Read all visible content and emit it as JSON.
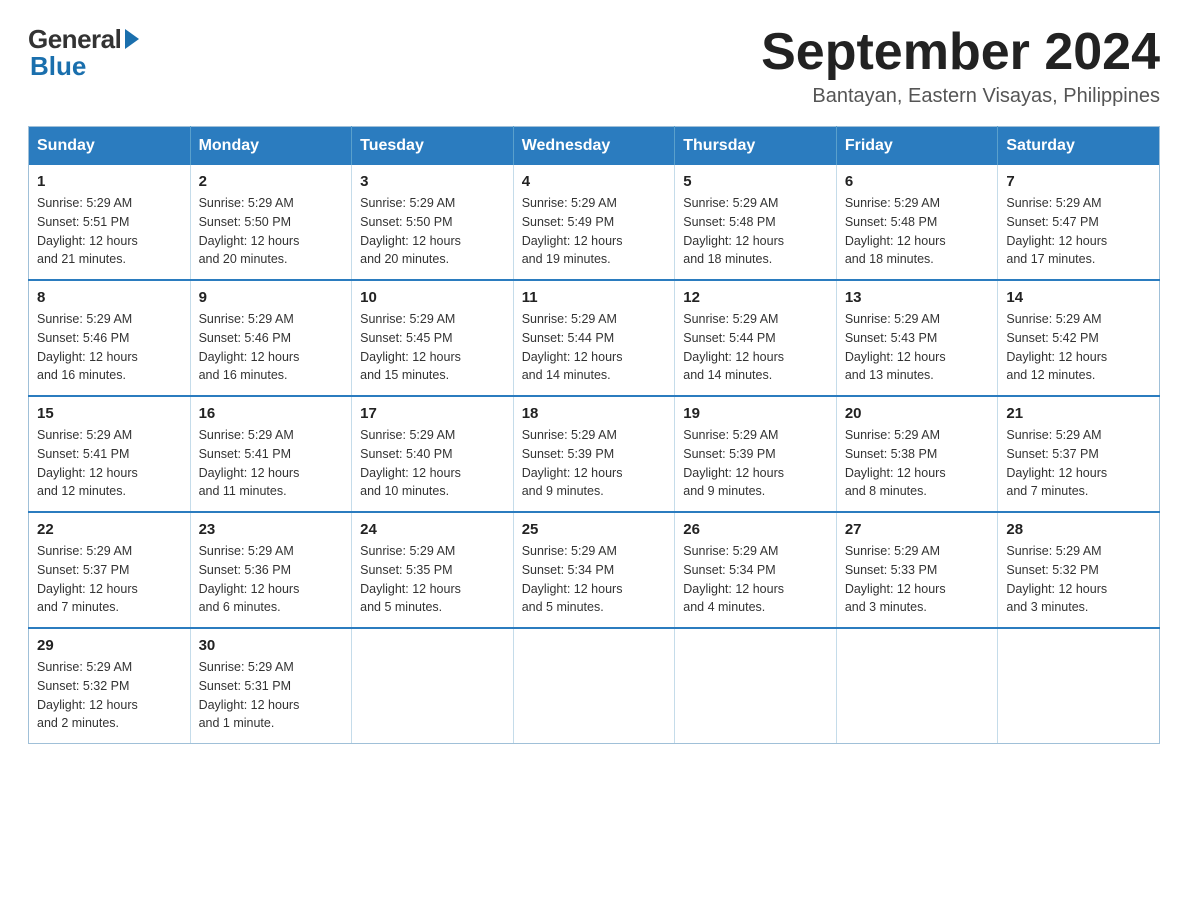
{
  "logo": {
    "general": "General",
    "blue": "Blue"
  },
  "title": "September 2024",
  "location": "Bantayan, Eastern Visayas, Philippines",
  "days_of_week": [
    "Sunday",
    "Monday",
    "Tuesday",
    "Wednesday",
    "Thursday",
    "Friday",
    "Saturday"
  ],
  "weeks": [
    [
      {
        "day": "1",
        "sunrise": "5:29 AM",
        "sunset": "5:51 PM",
        "daylight": "12 hours and 21 minutes."
      },
      {
        "day": "2",
        "sunrise": "5:29 AM",
        "sunset": "5:50 PM",
        "daylight": "12 hours and 20 minutes."
      },
      {
        "day": "3",
        "sunrise": "5:29 AM",
        "sunset": "5:50 PM",
        "daylight": "12 hours and 20 minutes."
      },
      {
        "day": "4",
        "sunrise": "5:29 AM",
        "sunset": "5:49 PM",
        "daylight": "12 hours and 19 minutes."
      },
      {
        "day": "5",
        "sunrise": "5:29 AM",
        "sunset": "5:48 PM",
        "daylight": "12 hours and 18 minutes."
      },
      {
        "day": "6",
        "sunrise": "5:29 AM",
        "sunset": "5:48 PM",
        "daylight": "12 hours and 18 minutes."
      },
      {
        "day": "7",
        "sunrise": "5:29 AM",
        "sunset": "5:47 PM",
        "daylight": "12 hours and 17 minutes."
      }
    ],
    [
      {
        "day": "8",
        "sunrise": "5:29 AM",
        "sunset": "5:46 PM",
        "daylight": "12 hours and 16 minutes."
      },
      {
        "day": "9",
        "sunrise": "5:29 AM",
        "sunset": "5:46 PM",
        "daylight": "12 hours and 16 minutes."
      },
      {
        "day": "10",
        "sunrise": "5:29 AM",
        "sunset": "5:45 PM",
        "daylight": "12 hours and 15 minutes."
      },
      {
        "day": "11",
        "sunrise": "5:29 AM",
        "sunset": "5:44 PM",
        "daylight": "12 hours and 14 minutes."
      },
      {
        "day": "12",
        "sunrise": "5:29 AM",
        "sunset": "5:44 PM",
        "daylight": "12 hours and 14 minutes."
      },
      {
        "day": "13",
        "sunrise": "5:29 AM",
        "sunset": "5:43 PM",
        "daylight": "12 hours and 13 minutes."
      },
      {
        "day": "14",
        "sunrise": "5:29 AM",
        "sunset": "5:42 PM",
        "daylight": "12 hours and 12 minutes."
      }
    ],
    [
      {
        "day": "15",
        "sunrise": "5:29 AM",
        "sunset": "5:41 PM",
        "daylight": "12 hours and 12 minutes."
      },
      {
        "day": "16",
        "sunrise": "5:29 AM",
        "sunset": "5:41 PM",
        "daylight": "12 hours and 11 minutes."
      },
      {
        "day": "17",
        "sunrise": "5:29 AM",
        "sunset": "5:40 PM",
        "daylight": "12 hours and 10 minutes."
      },
      {
        "day": "18",
        "sunrise": "5:29 AM",
        "sunset": "5:39 PM",
        "daylight": "12 hours and 9 minutes."
      },
      {
        "day": "19",
        "sunrise": "5:29 AM",
        "sunset": "5:39 PM",
        "daylight": "12 hours and 9 minutes."
      },
      {
        "day": "20",
        "sunrise": "5:29 AM",
        "sunset": "5:38 PM",
        "daylight": "12 hours and 8 minutes."
      },
      {
        "day": "21",
        "sunrise": "5:29 AM",
        "sunset": "5:37 PM",
        "daylight": "12 hours and 7 minutes."
      }
    ],
    [
      {
        "day": "22",
        "sunrise": "5:29 AM",
        "sunset": "5:37 PM",
        "daylight": "12 hours and 7 minutes."
      },
      {
        "day": "23",
        "sunrise": "5:29 AM",
        "sunset": "5:36 PM",
        "daylight": "12 hours and 6 minutes."
      },
      {
        "day": "24",
        "sunrise": "5:29 AM",
        "sunset": "5:35 PM",
        "daylight": "12 hours and 5 minutes."
      },
      {
        "day": "25",
        "sunrise": "5:29 AM",
        "sunset": "5:34 PM",
        "daylight": "12 hours and 5 minutes."
      },
      {
        "day": "26",
        "sunrise": "5:29 AM",
        "sunset": "5:34 PM",
        "daylight": "12 hours and 4 minutes."
      },
      {
        "day": "27",
        "sunrise": "5:29 AM",
        "sunset": "5:33 PM",
        "daylight": "12 hours and 3 minutes."
      },
      {
        "day": "28",
        "sunrise": "5:29 AM",
        "sunset": "5:32 PM",
        "daylight": "12 hours and 3 minutes."
      }
    ],
    [
      {
        "day": "29",
        "sunrise": "5:29 AM",
        "sunset": "5:32 PM",
        "daylight": "12 hours and 2 minutes."
      },
      {
        "day": "30",
        "sunrise": "5:29 AM",
        "sunset": "5:31 PM",
        "daylight": "12 hours and 1 minute."
      },
      null,
      null,
      null,
      null,
      null
    ]
  ],
  "labels": {
    "sunrise": "Sunrise:",
    "sunset": "Sunset:",
    "daylight": "Daylight:"
  }
}
